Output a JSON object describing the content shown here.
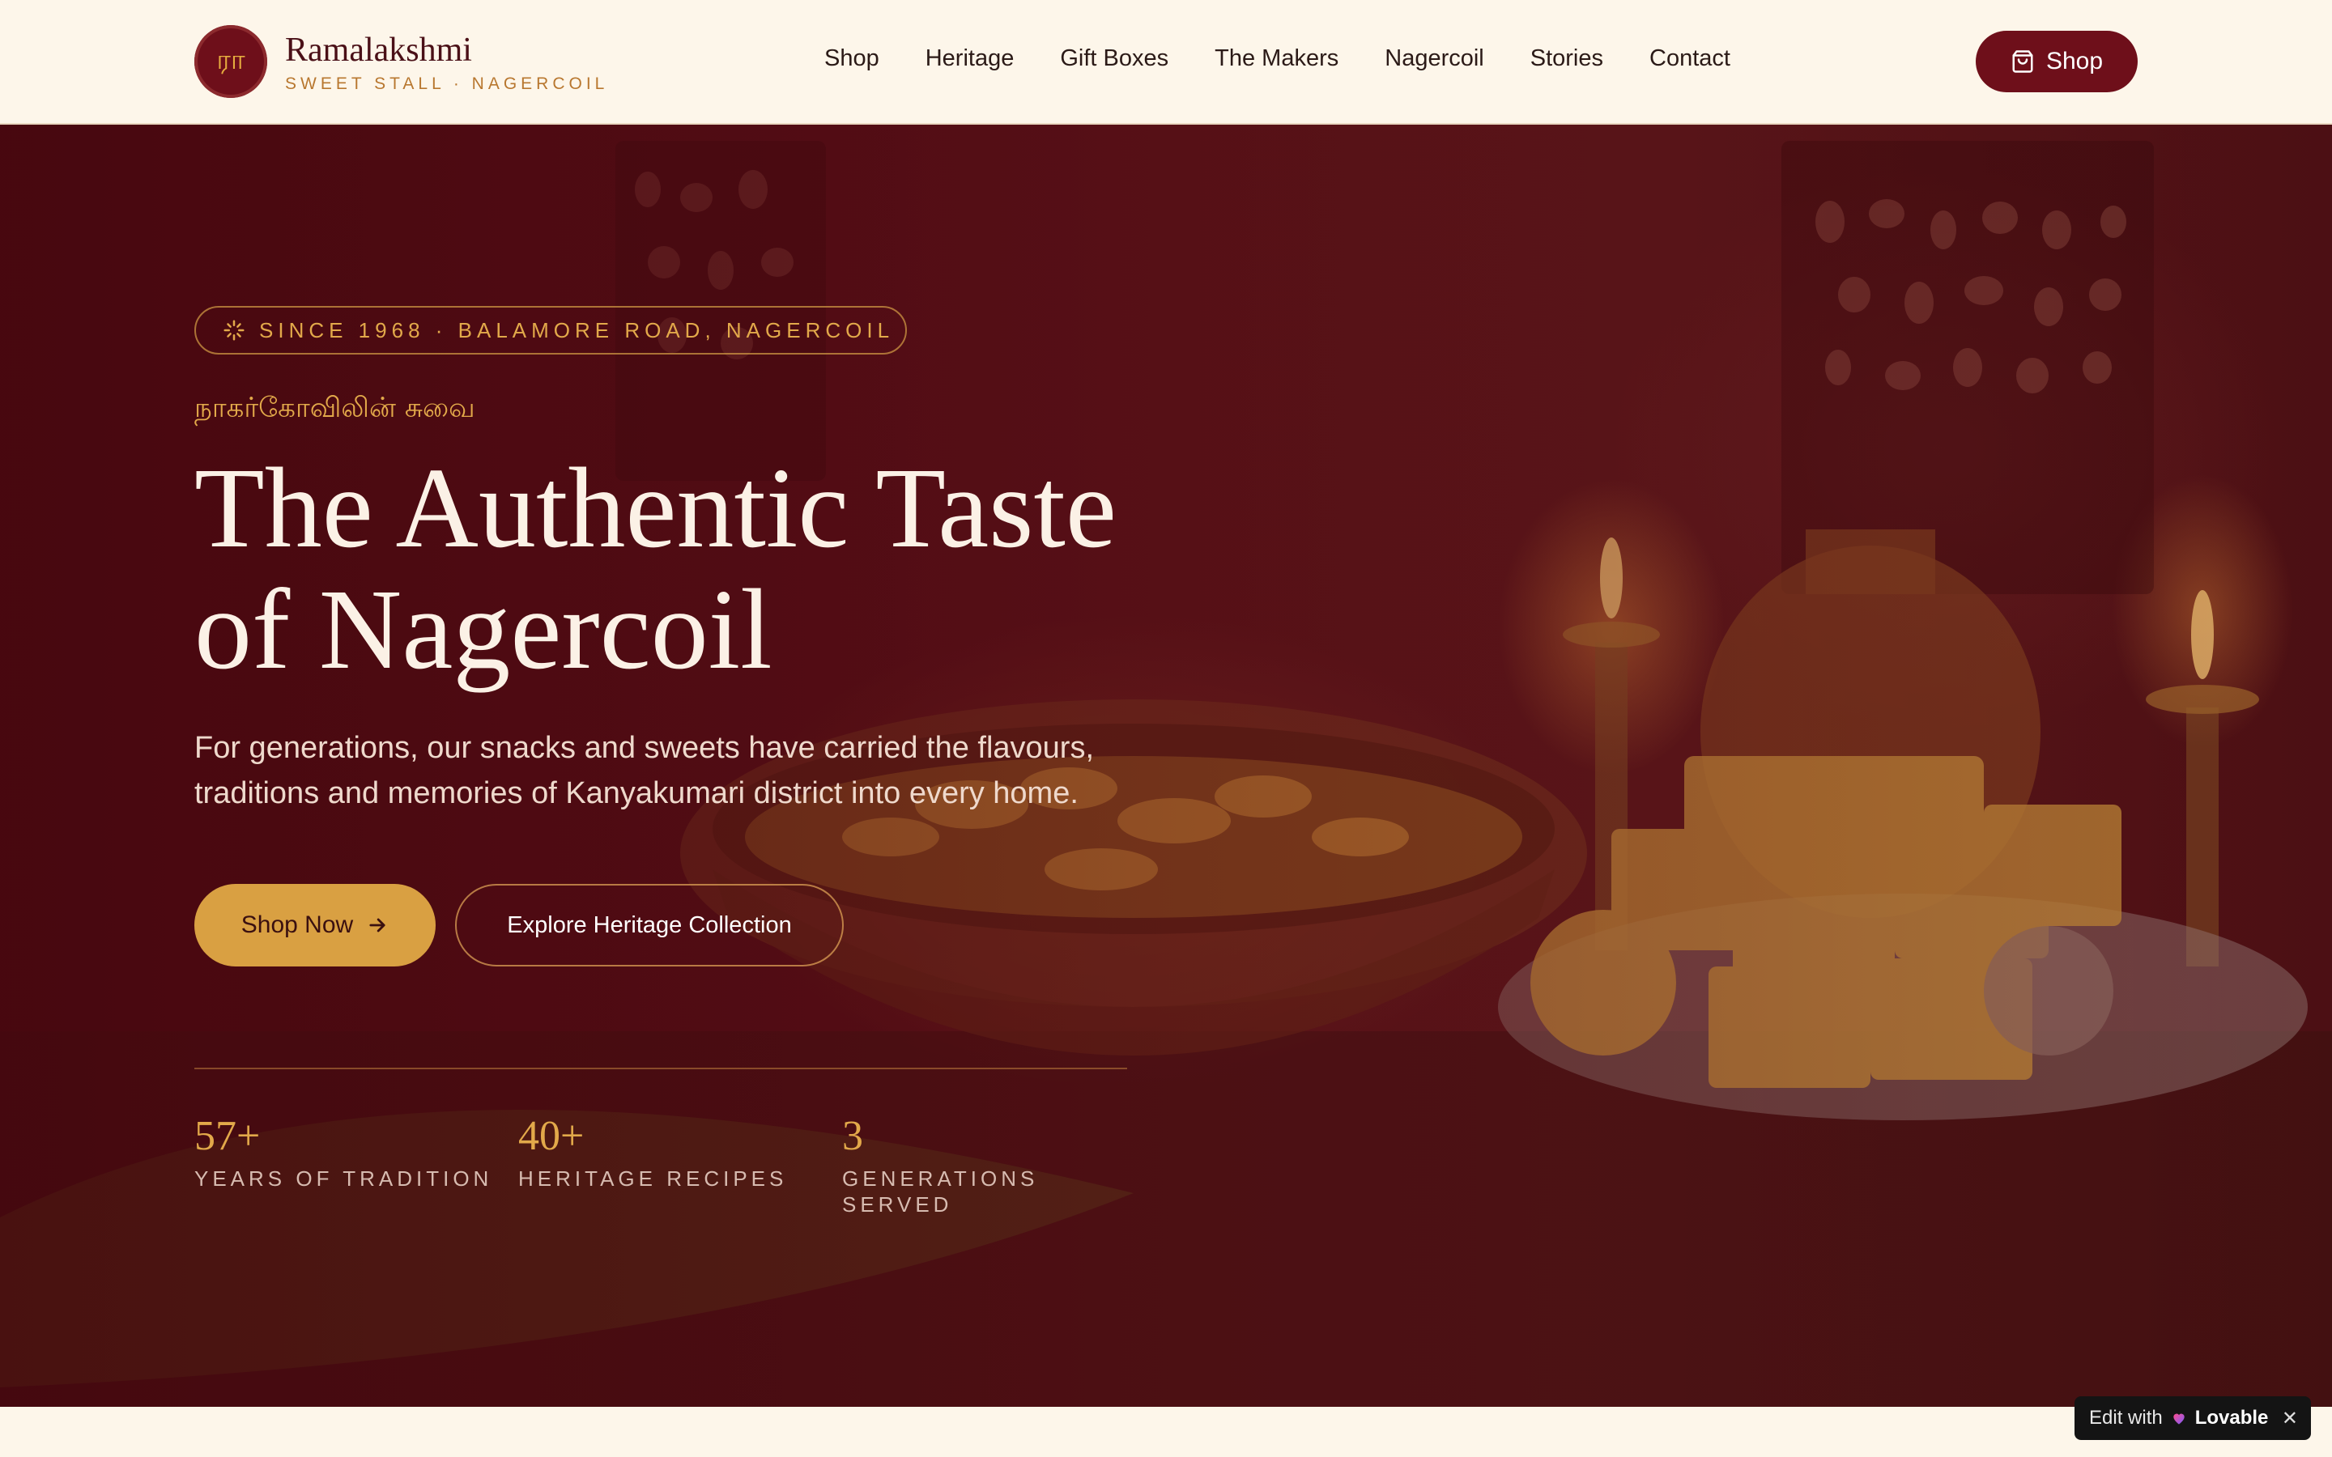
{
  "header": {
    "logo_glyph": "ரா",
    "brand_name": "Ramalakshmi",
    "brand_tagline": "SWEET STALL · NAGERCOIL",
    "nav": [
      "Shop",
      "Heritage",
      "Gift Boxes",
      "The Makers",
      "Nagercoil",
      "Stories",
      "Contact"
    ],
    "shop_button": "Shop"
  },
  "hero": {
    "badge": "SINCE 1968 · BALAMORE ROAD, NAGERCOIL",
    "tamil_line": "நாகர்கோவிலின் சுவை",
    "title_line1": "The Authentic Taste",
    "title_line2": "of Nagercoil",
    "description": "For generations, our snacks and sweets have carried the flavours, traditions and memories of Kanyakumari district into every home.",
    "primary_cta": "Shop Now",
    "secondary_cta": "Explore Heritage Collection",
    "stats": [
      {
        "value": "57+",
        "label": "YEARS OF TRADITION"
      },
      {
        "value": "40+",
        "label": "HERITAGE RECIPES"
      },
      {
        "value": "3",
        "label": "GENERATIONS SERVED"
      }
    ]
  },
  "badge_widget": {
    "prefix": "Edit with",
    "brand": "Lovable",
    "close": "✕"
  },
  "colors": {
    "maroon": "#6e0f1a",
    "gold": "#d9a042",
    "cream": "#fdf6ea"
  },
  "icons": [
    "shopping-bag-icon",
    "sparkle-icon",
    "arrow-right-icon",
    "lovable-heart-icon",
    "close-icon"
  ]
}
